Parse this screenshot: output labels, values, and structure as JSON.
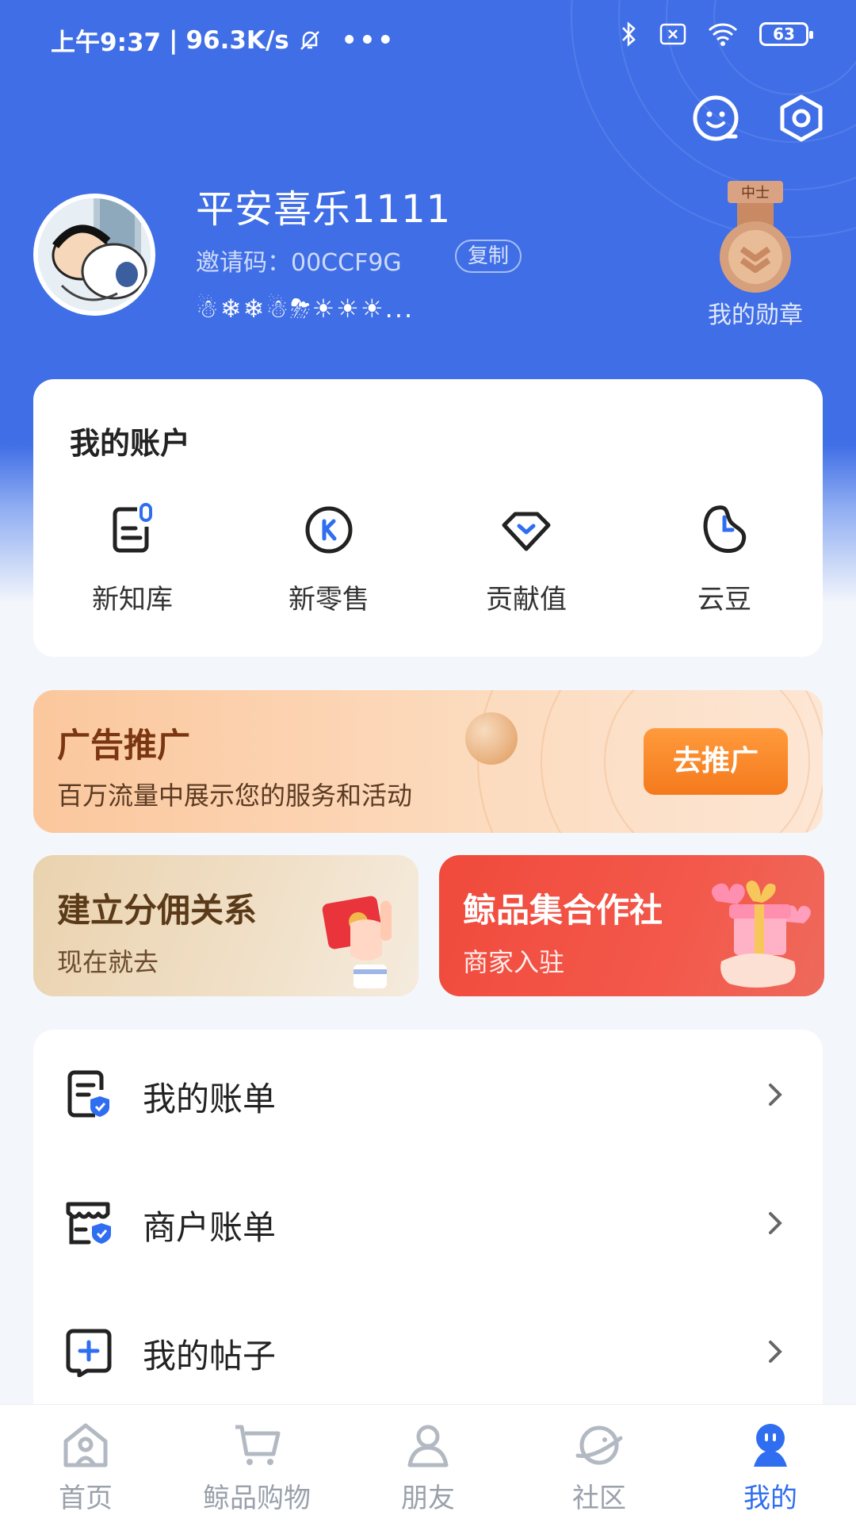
{
  "status_bar": {
    "time": "上午9:37",
    "speed": "96.3K/s",
    "battery": "63"
  },
  "profile": {
    "username": "平安喜乐1111",
    "invite_label": "邀请码：",
    "invite_code": "00CCF9G",
    "copy_label": "复制",
    "weather_icons": "☃❄❄☃⛈☀☀☀...",
    "medal_rank": "中士",
    "medal_label": "我的勋章"
  },
  "account": {
    "title": "我的账户",
    "items": [
      {
        "label": "新知库",
        "icon": "knowledge-icon"
      },
      {
        "label": "新零售",
        "icon": "retail-icon"
      },
      {
        "label": "贡献值",
        "icon": "diamond-icon"
      },
      {
        "label": "云豆",
        "icon": "bean-icon"
      }
    ]
  },
  "promo": {
    "title": "广告推广",
    "subtitle": "百万流量中展示您的服务和活动",
    "button": "去推广"
  },
  "tiles": [
    {
      "title": "建立分佣关系",
      "subtitle": "现在就去"
    },
    {
      "title": "鲸品集合作社",
      "subtitle": "商家入驻"
    }
  ],
  "menu": [
    {
      "label": "我的账单",
      "icon": "bill-shield-icon"
    },
    {
      "label": "商户账单",
      "icon": "store-shield-icon"
    },
    {
      "label": "我的帖子",
      "icon": "post-add-icon"
    }
  ],
  "tabbar": [
    {
      "label": "首页",
      "icon": "home-icon"
    },
    {
      "label": "鲸品购物",
      "icon": "cart-icon"
    },
    {
      "label": "朋友",
      "icon": "friends-icon"
    },
    {
      "label": "社区",
      "icon": "planet-icon"
    },
    {
      "label": "我的",
      "icon": "profile-icon",
      "active": true
    }
  ],
  "colors": {
    "primary": "#3f6ee6",
    "active_tab": "#2f6ef0",
    "promo_button": "#f47a1c",
    "tile_red": "#f04a3c"
  }
}
